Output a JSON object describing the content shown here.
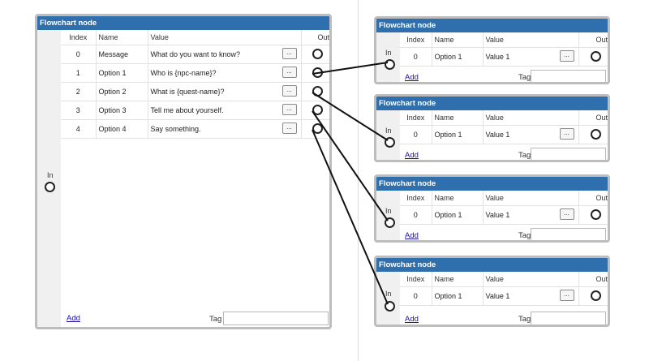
{
  "main_node": {
    "title": "Flowchart node",
    "in_label": "In",
    "columns": {
      "index": "Index",
      "name": "Name",
      "value": "Value",
      "out": "Out"
    },
    "rows": [
      {
        "index": "0",
        "name": "Message",
        "value": "What do you want to know?",
        "button": "..."
      },
      {
        "index": "1",
        "name": "Option 1",
        "value": "Who is {npc-name}?",
        "button": "..."
      },
      {
        "index": "2",
        "name": "Option 2",
        "value": "What is {quest-name}?",
        "button": "..."
      },
      {
        "index": "3",
        "name": "Option 3",
        "value": "Tell me about yourself.",
        "button": "..."
      },
      {
        "index": "4",
        "name": "Option 4",
        "value": "Say something.",
        "button": "..."
      }
    ],
    "add_label": "Add",
    "tag_label": "Tag",
    "tag_value": ""
  },
  "child_nodes": [
    {
      "title": "Flowchart node",
      "in_label": "In",
      "columns": {
        "index": "Index",
        "name": "Name",
        "value": "Value",
        "out": "Out"
      },
      "row": {
        "index": "0",
        "name": "Option 1",
        "value": "Value 1",
        "button": "..."
      },
      "add_label": "Add",
      "tag_label": "Tag",
      "tag_value": ""
    },
    {
      "title": "Flowchart node",
      "in_label": "In",
      "columns": {
        "index": "Index",
        "name": "Name",
        "value": "Value",
        "out": "Out"
      },
      "row": {
        "index": "0",
        "name": "Option 1",
        "value": "Value 1",
        "button": "..."
      },
      "add_label": "Add",
      "tag_label": "Tag",
      "tag_value": ""
    },
    {
      "title": "Flowchart node",
      "in_label": "In",
      "columns": {
        "index": "Index",
        "name": "Name",
        "value": "Value",
        "out": "Out"
      },
      "row": {
        "index": "0",
        "name": "Option 1",
        "value": "Value 1",
        "button": "..."
      },
      "add_label": "Add",
      "tag_label": "Tag",
      "tag_value": ""
    },
    {
      "title": "Flowchart node",
      "in_label": "In",
      "columns": {
        "index": "Index",
        "name": "Name",
        "value": "Value",
        "out": "Out"
      },
      "row": {
        "index": "0",
        "name": "Option 1",
        "value": "Value 1",
        "button": "..."
      },
      "add_label": "Add",
      "tag_label": "Tag",
      "tag_value": ""
    }
  ],
  "colors": {
    "title_bar": "#2f6fad",
    "node_border": "#bdbdbd",
    "link": "#1a0dab"
  }
}
